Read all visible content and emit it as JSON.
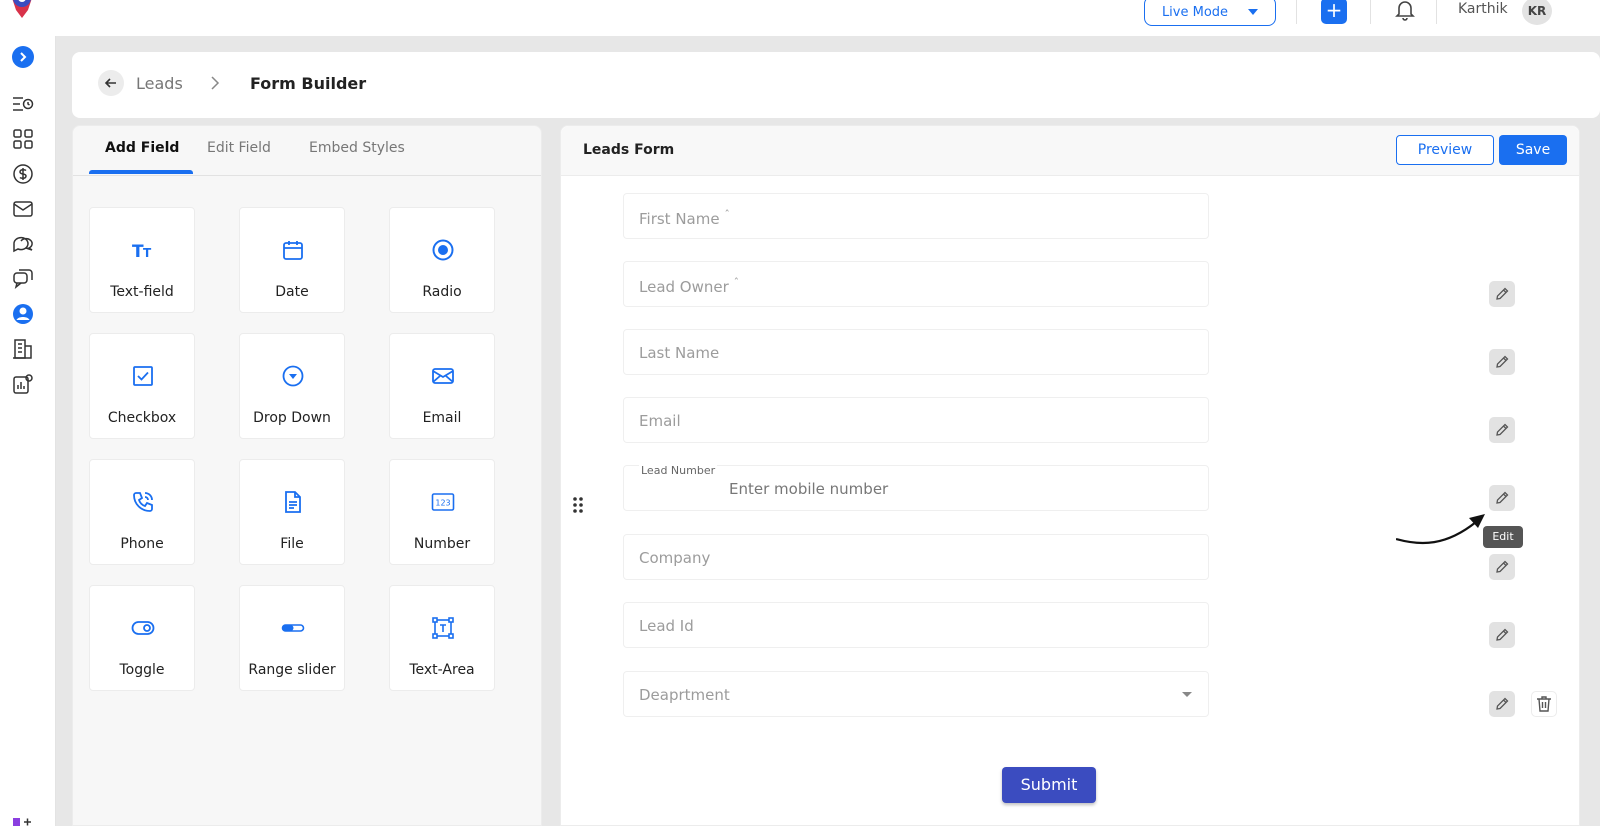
{
  "colors": {
    "accent": "#1a6ff0",
    "submit": "#3b4cc0",
    "page_bg": "#e7e7e7"
  },
  "topbar": {
    "mode_select": {
      "value": "Live Mode"
    },
    "add_icon": "plus-icon",
    "notifications_icon": "bell-icon",
    "user": {
      "name": "Karthik",
      "initials": "KR"
    }
  },
  "sidebar": {
    "items": [
      "expand-icon",
      "timeline-icon",
      "dashboard-icon",
      "dollar-icon",
      "mail-icon",
      "chat-icon",
      "messages-icon",
      "user-icon",
      "building-icon",
      "analytics-settings-icon"
    ]
  },
  "breadcrumb": {
    "parent": "Leads",
    "current": "Form Builder"
  },
  "left_panel": {
    "tabs": [
      {
        "label": "Add Field",
        "active": true
      },
      {
        "label": "Edit Field",
        "active": false
      },
      {
        "label": "Embed Styles",
        "active": false
      }
    ],
    "field_types": [
      {
        "label": "Text-field",
        "icon": "text-icon"
      },
      {
        "label": "Date",
        "icon": "calendar-icon"
      },
      {
        "label": "Radio",
        "icon": "radio-icon"
      },
      {
        "label": "Checkbox",
        "icon": "checkbox-icon"
      },
      {
        "label": "Drop Down",
        "icon": "dropdown-icon"
      },
      {
        "label": "Email",
        "icon": "email-icon"
      },
      {
        "label": "Phone",
        "icon": "phone-icon"
      },
      {
        "label": "File",
        "icon": "file-icon"
      },
      {
        "label": "Number",
        "icon": "number-icon"
      },
      {
        "label": "Toggle",
        "icon": "toggle-icon"
      },
      {
        "label": "Range slider",
        "icon": "range-slider-icon"
      },
      {
        "label": "Text-Area",
        "icon": "textarea-icon"
      }
    ]
  },
  "form": {
    "title": "Leads Form",
    "preview_label": "Preview",
    "save_label": "Save",
    "fields": [
      {
        "placeholder": "First Name",
        "required": true
      },
      {
        "placeholder": "Lead Owner",
        "required": true
      },
      {
        "placeholder": "Last Name",
        "required": false
      },
      {
        "placeholder": "Email",
        "required": false
      },
      {
        "label": "Lead Number",
        "placeholder": "Enter mobile number",
        "required": false
      },
      {
        "placeholder": "Company",
        "required": false
      },
      {
        "placeholder": "Lead Id",
        "required": false
      },
      {
        "placeholder": "Deaprtment",
        "required": false,
        "type": "dropdown"
      }
    ],
    "required_mark": "ˆ",
    "tooltip": "Edit",
    "submit_label": "Submit"
  }
}
